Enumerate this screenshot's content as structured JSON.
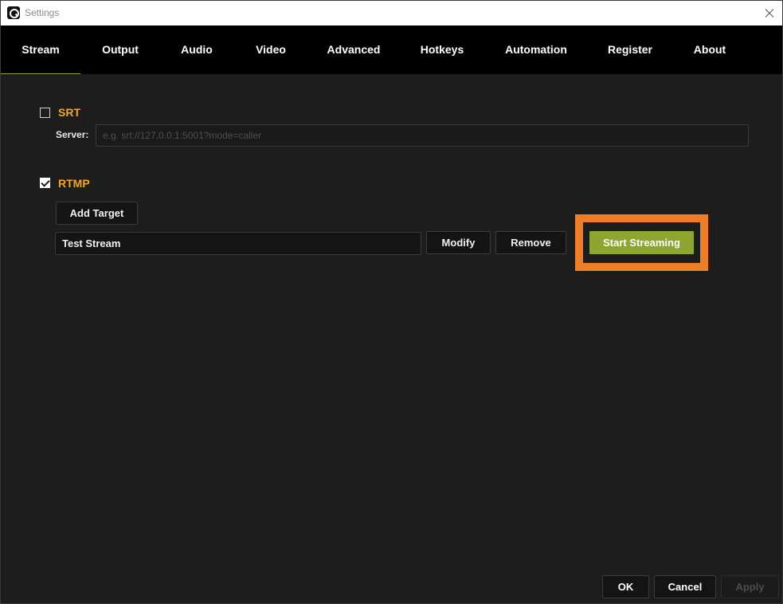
{
  "window": {
    "title": "Settings"
  },
  "tabs": [
    {
      "label": "Stream",
      "active": true
    },
    {
      "label": "Output"
    },
    {
      "label": "Audio"
    },
    {
      "label": "Video"
    },
    {
      "label": "Advanced"
    },
    {
      "label": "Hotkeys"
    },
    {
      "label": "Automation"
    },
    {
      "label": "Register"
    },
    {
      "label": "About"
    }
  ],
  "srt": {
    "label": "SRT",
    "checked": false,
    "server_label": "Server:",
    "server_placeholder": "e.g. srt://127.0.0.1:5001?mode=caller",
    "server_value": ""
  },
  "rtmp": {
    "label": "RTMP",
    "checked": true,
    "add_target_label": "Add Target",
    "target_name": "Test Stream",
    "modify_label": "Modify",
    "remove_label": "Remove",
    "start_streaming_label": "Start Streaming"
  },
  "footer": {
    "ok_label": "OK",
    "cancel_label": "Cancel",
    "apply_label": "Apply",
    "apply_enabled": false
  },
  "colors": {
    "accent_orange": "#f5a623",
    "highlight_box": "#ee7d27",
    "start_button": "#8ea52f",
    "tab_bar": "#000000",
    "background": "#1d1d1d"
  },
  "icons": {
    "app": "app-logo-icon",
    "close": "close-icon",
    "srt_checkbox": "checkbox-unchecked-icon",
    "rtmp_checkbox": "checkbox-checked-icon"
  }
}
